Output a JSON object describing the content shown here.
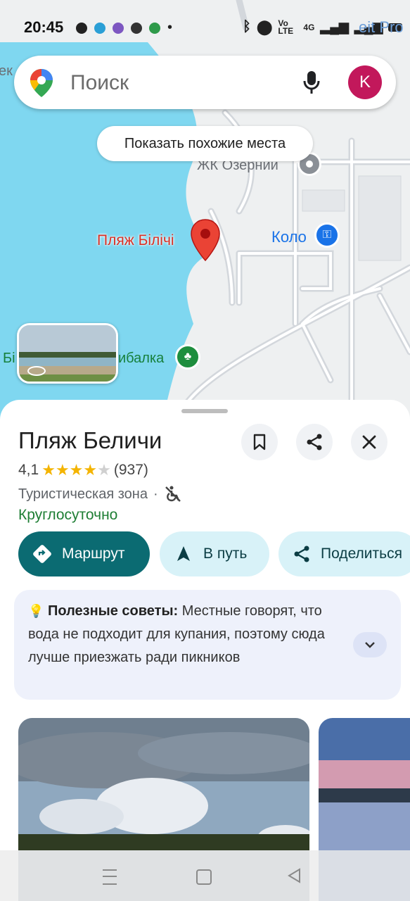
{
  "status_bar": {
    "time": "20:45",
    "network_text": "4G",
    "volte_text": "Vo LTE",
    "overlay_text": "eit Pro"
  },
  "search": {
    "placeholder": "Поиск",
    "avatar_letter": "K"
  },
  "map": {
    "chip_label": "Показать похожие места",
    "labels": {
      "residential": "ЖК Озерний",
      "shop": "Коло",
      "pin_label": "Пляж Білічі",
      "left_edge": "ек",
      "fishing_left": "Бі",
      "fishing_right": "ибалка"
    }
  },
  "place": {
    "title": "Пляж Беличи",
    "rating": "4,1",
    "stars_filled": 4,
    "reviews": "(937)",
    "category": "Туристическая зона",
    "separator": "·",
    "hours": "Круглосуточно"
  },
  "actions": {
    "route": "Маршрут",
    "start": "В путь",
    "share": "Поделиться"
  },
  "tips": {
    "label": "Полезные советы:",
    "text": " Местные говорят, что вода не подходит для купания, поэтому сюда лучше приезжать ради пикников"
  },
  "colors": {
    "water": "#7fd7f0",
    "route_button": "#0b6b72",
    "secondary_button": "#d8f2f8",
    "hours_green": "#1e7e34",
    "pin_red": "#ea4335",
    "avatar": "#c2185b",
    "star": "#f4b400"
  }
}
